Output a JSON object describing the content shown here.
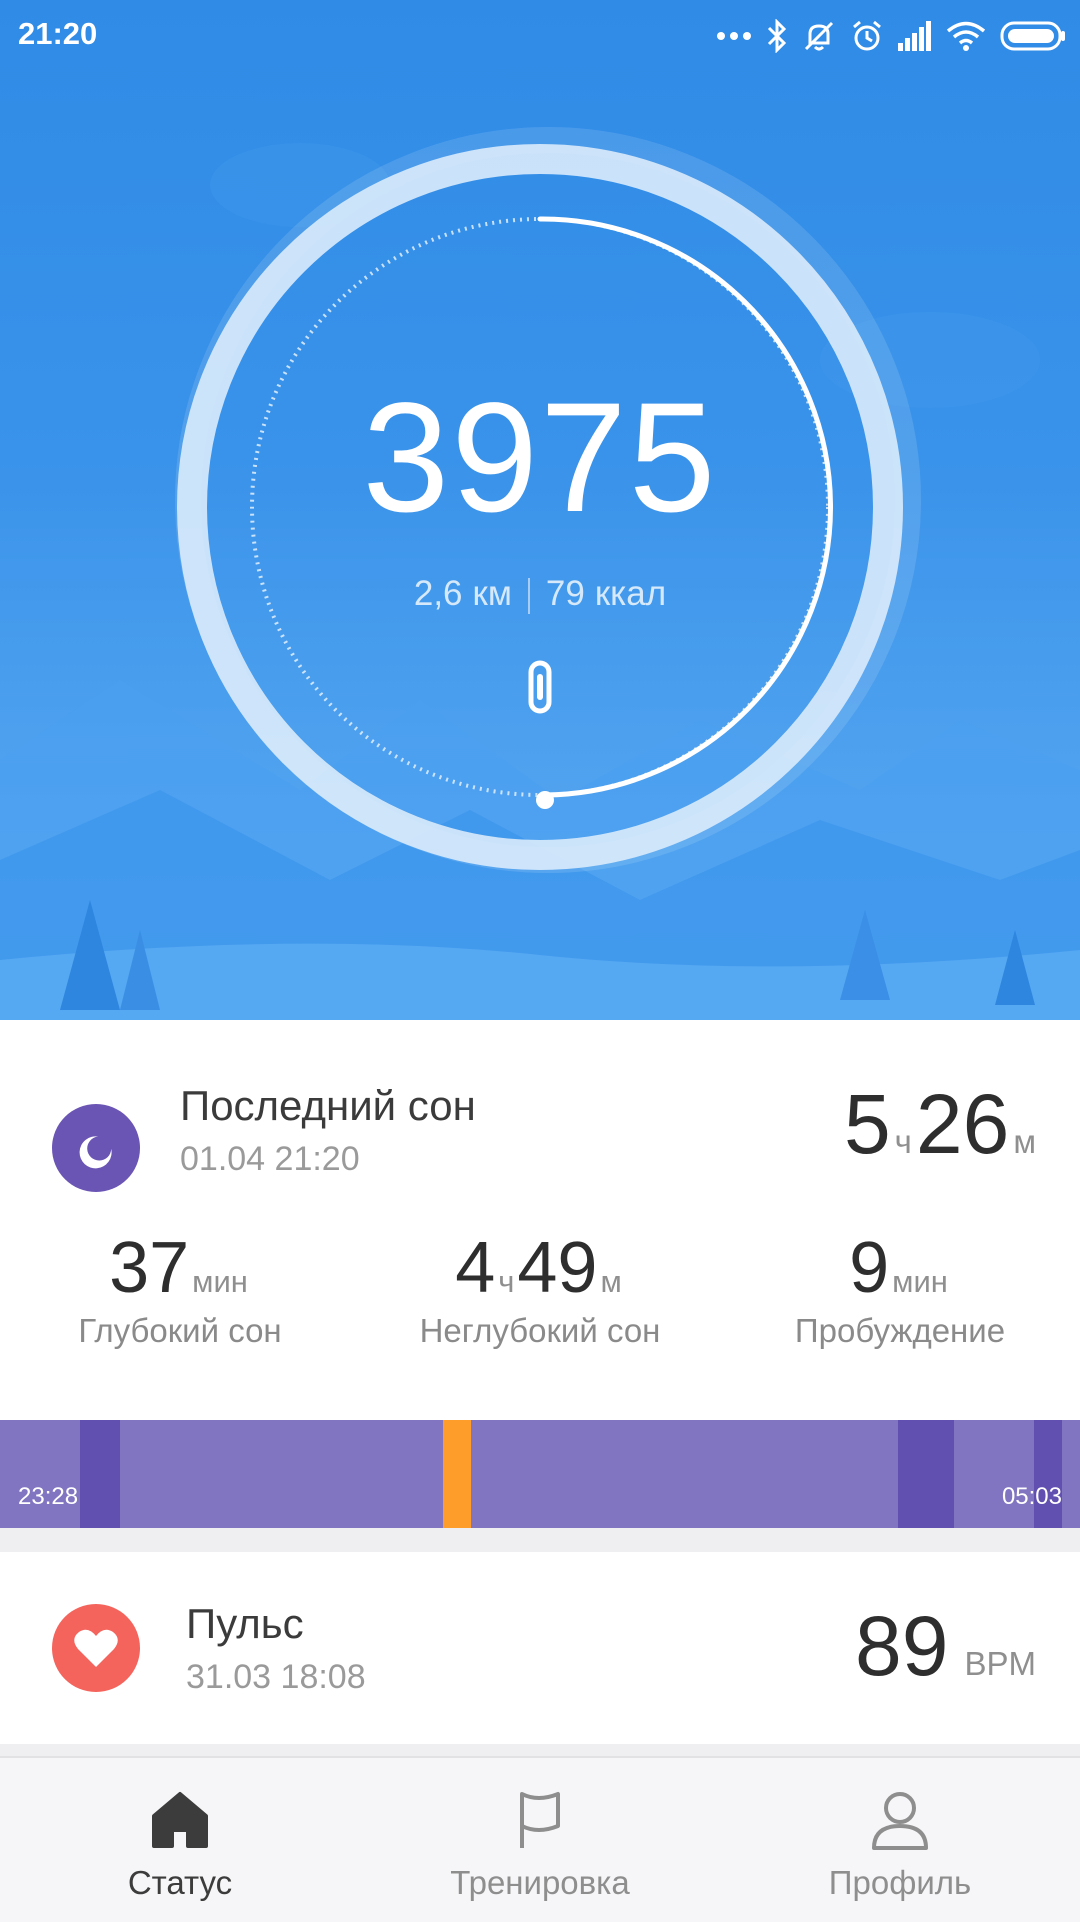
{
  "status_bar": {
    "time": "21:20",
    "icons": [
      "more-dots-icon",
      "bluetooth-icon",
      "mute-icon",
      "alarm-icon",
      "signal-icon",
      "wifi-icon",
      "battery-icon"
    ]
  },
  "activity": {
    "steps": "3975",
    "distance_value": "2,6",
    "distance_unit": "км",
    "calories_value": "79",
    "calories_unit": "ккал",
    "goal_progress": 0.5,
    "device_icon": "band-icon"
  },
  "sleep": {
    "title": "Последний сон",
    "date": "01.04 21:20",
    "total_hours": "5",
    "hours_unit": "ч",
    "total_minutes": "26",
    "minutes_unit": "м",
    "metrics": [
      {
        "value_1": "37",
        "unit_1": "мин",
        "value_2": "",
        "unit_2": "",
        "label": "Глубокий сон"
      },
      {
        "value_1": "4",
        "unit_1": "ч",
        "value_2": "49",
        "unit_2": "м",
        "label": "Неглубокий сон"
      },
      {
        "value_1": "9",
        "unit_1": "мин",
        "value_2": "",
        "unit_2": "",
        "label": "Пробуждение"
      }
    ],
    "timeline": {
      "start": "23:28",
      "end": "05:03",
      "colors": {
        "light": "#8175c2",
        "deep": "#6150b0",
        "awake": "#ff9d2a"
      }
    }
  },
  "pulse": {
    "title": "Пульс",
    "date": "31.03 18:08",
    "value": "89",
    "unit": "BPM"
  },
  "nav": {
    "items": [
      {
        "label": "Статус",
        "icon": "home-icon",
        "active": true
      },
      {
        "label": "Тренировка",
        "icon": "flag-icon",
        "active": false
      },
      {
        "label": "Профиль",
        "icon": "profile-icon",
        "active": false
      }
    ]
  },
  "colors": {
    "hero_blue": "#2f8be6",
    "sleep_purple": "#6a54b4",
    "pulse_red": "#f4645c",
    "active_nav": "#3c3c3c",
    "inactive_nav": "#9a9a9a"
  }
}
